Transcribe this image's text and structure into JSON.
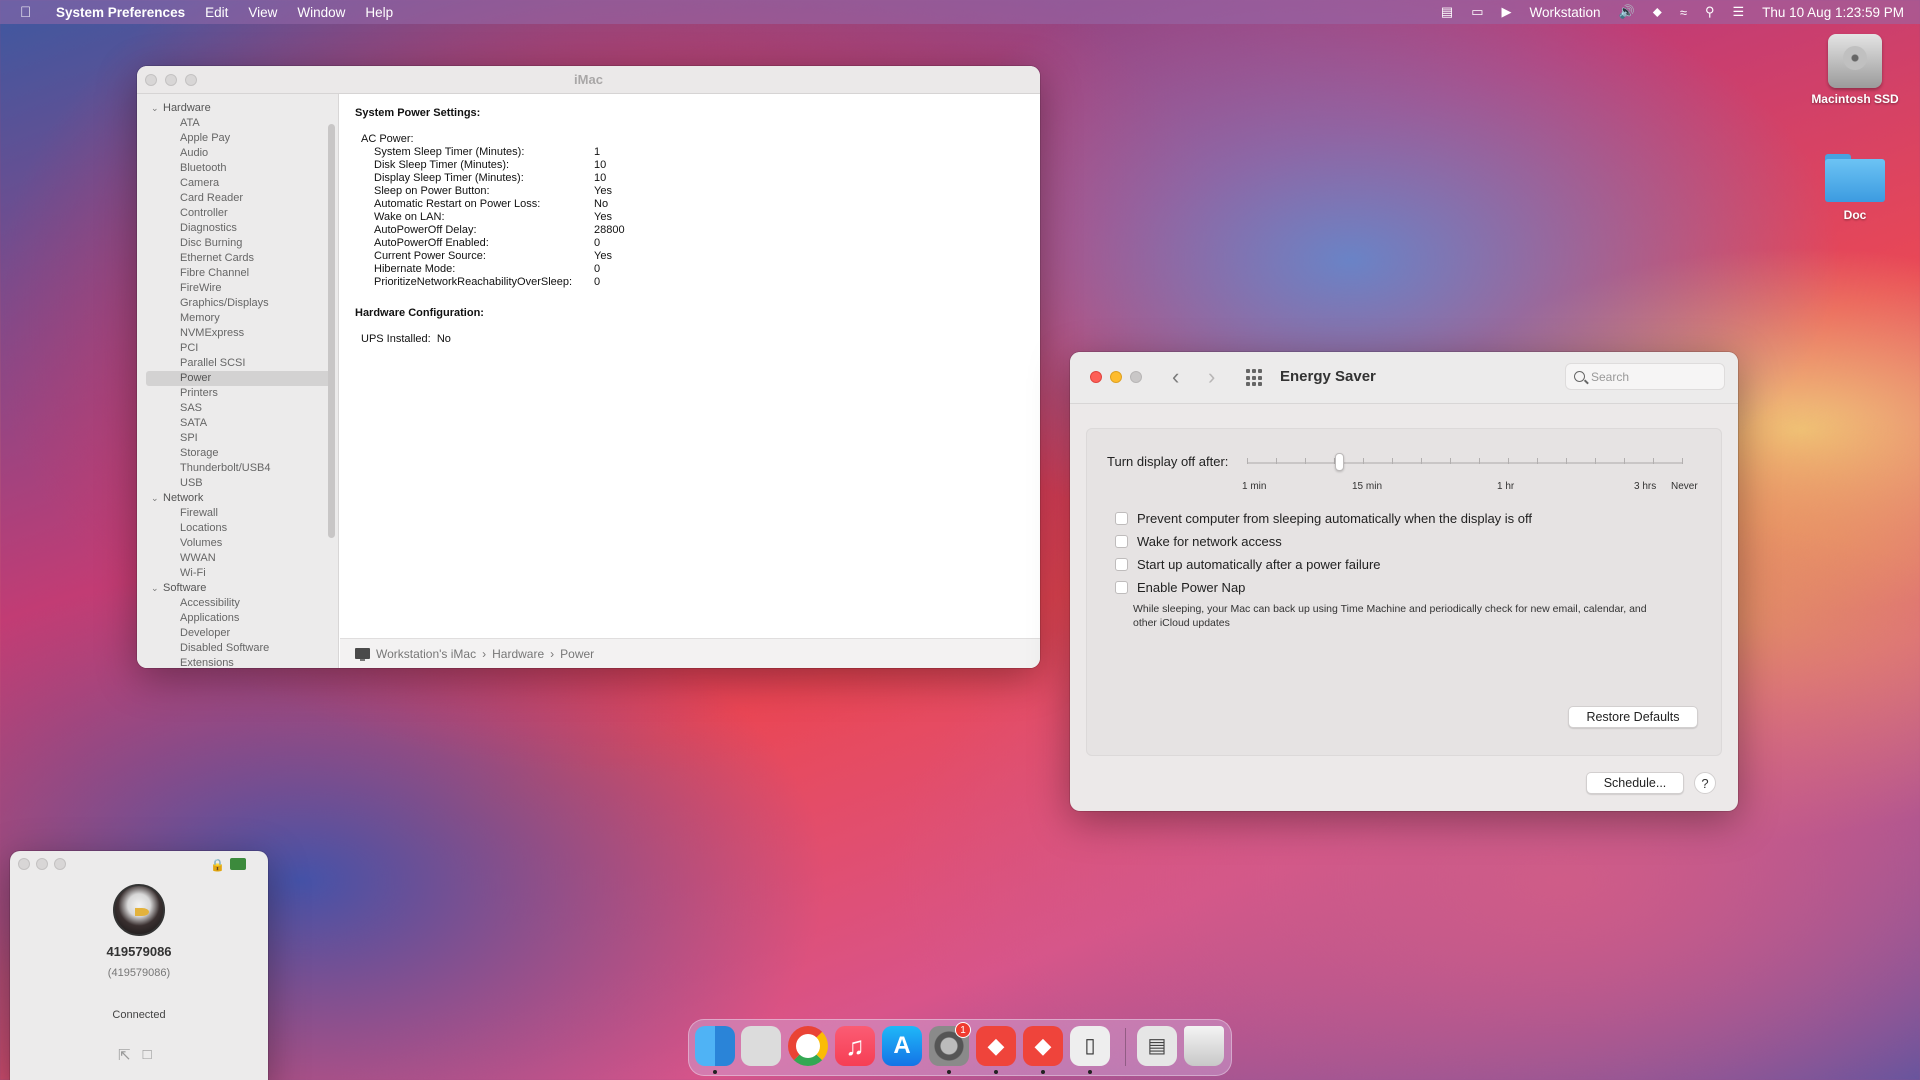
{
  "menubar": {
    "app": "System Preferences",
    "menus": [
      "Edit",
      "View",
      "Window",
      "Help"
    ],
    "user": "Workstation",
    "datetime": "Thu 10 Aug  1:23:59 PM"
  },
  "desktop": {
    "icons": [
      {
        "label": "Macintosh SSD",
        "icon": "hard-drive-icon"
      },
      {
        "label": "Doc",
        "icon": "folder-icon"
      }
    ]
  },
  "sysinfo": {
    "title": "iMac",
    "sidebar": {
      "hardware": "Hardware",
      "hardware_items": [
        "ATA",
        "Apple Pay",
        "Audio",
        "Bluetooth",
        "Camera",
        "Card Reader",
        "Controller",
        "Diagnostics",
        "Disc Burning",
        "Ethernet Cards",
        "Fibre Channel",
        "FireWire",
        "Graphics/Displays",
        "Memory",
        "NVMExpress",
        "PCI",
        "Parallel SCSI",
        "Power",
        "Printers",
        "SAS",
        "SATA",
        "SPI",
        "Storage",
        "Thunderbolt/USB4",
        "USB"
      ],
      "network": "Network",
      "network_items": [
        "Firewall",
        "Locations",
        "Volumes",
        "WWAN",
        "Wi-Fi"
      ],
      "software": "Software",
      "software_items": [
        "Accessibility",
        "Applications",
        "Developer",
        "Disabled Software",
        "Extensions"
      ],
      "selected": "Power"
    },
    "content": {
      "heading1": "System Power Settings:",
      "ac_power": "AC Power:",
      "settings": [
        {
          "k": "System Sleep Timer (Minutes):",
          "v": "1"
        },
        {
          "k": "Disk Sleep Timer (Minutes):",
          "v": "10"
        },
        {
          "k": "Display Sleep Timer (Minutes):",
          "v": "10"
        },
        {
          "k": "Sleep on Power Button:",
          "v": "Yes"
        },
        {
          "k": "Automatic Restart on Power Loss:",
          "v": "No"
        },
        {
          "k": "Wake on LAN:",
          "v": "Yes"
        },
        {
          "k": "AutoPowerOff Delay:",
          "v": "28800"
        },
        {
          "k": "AutoPowerOff Enabled:",
          "v": "0"
        },
        {
          "k": "Current Power Source:",
          "v": "Yes"
        },
        {
          "k": "Hibernate Mode:",
          "v": "0"
        },
        {
          "k": "PrioritizeNetworkReachabilityOverSleep:",
          "v": "0"
        }
      ],
      "heading2": "Hardware Configuration:",
      "ups_label": "UPS Installed:",
      "ups_value": "No"
    },
    "path": {
      "computer": "Workstation's iMac",
      "sep": "›",
      "section": "Hardware",
      "item": "Power"
    }
  },
  "energy": {
    "title": "Energy Saver",
    "search_placeholder": "Search",
    "slider_label": "Turn display off after:",
    "slider_value": "15 min",
    "tick_labels": [
      "1 min",
      "15 min",
      "1 hr",
      "3 hrs",
      "Never"
    ],
    "options": [
      "Prevent computer from sleeping automatically when the display is off",
      "Wake for network access",
      "Start up automatically after a power failure",
      "Enable Power Nap"
    ],
    "power_nap_note": "While sleeping, your Mac can back up using Time Machine and periodically check for new email, calendar, and other iCloud updates",
    "restore_defaults": "Restore Defaults",
    "schedule": "Schedule...",
    "help": "?"
  },
  "remote": {
    "id": "419579086",
    "id_sub": "(419579086)",
    "status": "Connected"
  },
  "dock": {
    "apps": [
      "finder-icon",
      "launchpad-icon",
      "chrome-icon",
      "music-icon",
      "app-store-icon",
      "system-preferences-icon",
      "anydesk-icon",
      "anydesk-remote-icon",
      "preview-icon",
      "storage-icon",
      "trash-icon"
    ],
    "badge": "1"
  }
}
